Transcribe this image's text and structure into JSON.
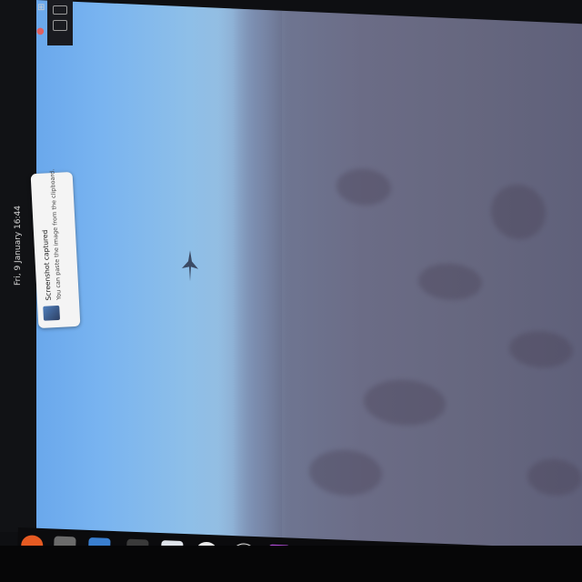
{
  "topbar": {
    "clock": "Fri, 9 January 16:44"
  },
  "notification": {
    "title": "Screenshot captured",
    "body": "You can paste the image from the clipboard."
  },
  "dock": {
    "items": [
      {
        "name": "firefox-icon",
        "color": "#e65a22"
      },
      {
        "name": "app-icon",
        "color": "#6b6b6b"
      },
      {
        "name": "files-icon",
        "color": "#3a7fd0"
      },
      {
        "name": "monitor-icon",
        "color": "#3a3a3a"
      },
      {
        "name": "edit-icon",
        "color": "#dfe3ea"
      },
      {
        "name": "yandex-icon",
        "color": "#e8e8e8"
      },
      {
        "name": "obs-icon",
        "color": "#222222"
      },
      {
        "name": "shotcut-icon",
        "color": "#b04bd6"
      },
      {
        "name": "drive-icon",
        "color": "#8a8a8a"
      },
      {
        "name": "app-icon-2",
        "color": "#5fae4e"
      }
    ]
  }
}
